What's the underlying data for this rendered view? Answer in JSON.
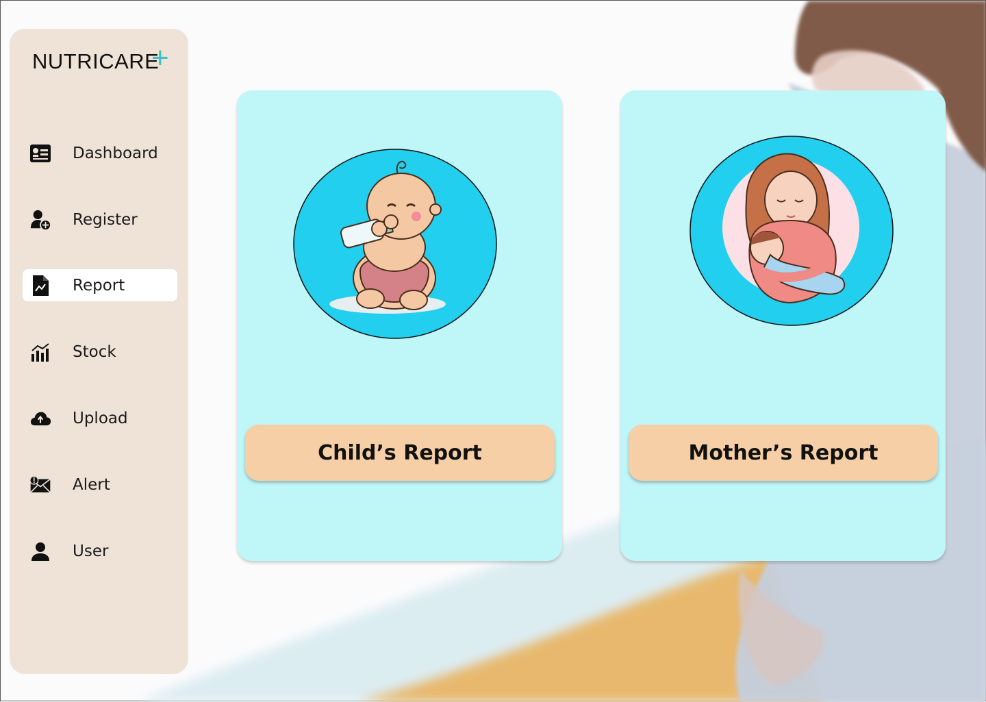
{
  "app": {
    "logo_text": "NUTRICARE",
    "logo_plus": "+",
    "accent_color": "#3ec2c9"
  },
  "sidebar": {
    "items": [
      {
        "label": "Dashboard",
        "icon": "dashboard-icon",
        "active": false
      },
      {
        "label": "Register",
        "icon": "add-user-icon",
        "active": false
      },
      {
        "label": "Report",
        "icon": "report-icon",
        "active": true
      },
      {
        "label": "Stock",
        "icon": "stock-chart-icon",
        "active": false
      },
      {
        "label": "Upload",
        "icon": "cloud-upload-icon",
        "active": false
      },
      {
        "label": "Alert",
        "icon": "alert-mail-icon",
        "active": false
      },
      {
        "label": "User",
        "icon": "user-icon",
        "active": false
      }
    ]
  },
  "cards": {
    "child": {
      "button_label": "Child’s Report",
      "image": "baby-drinking-bottle-illustration"
    },
    "mother": {
      "button_label": "Mother’s Report",
      "image": "mother-holding-baby-illustration"
    }
  },
  "colors": {
    "sidebar_bg": "#efe3d8",
    "card_bg": "#bff6f8",
    "button_bg": "#f7cfa6",
    "avatar_bg": "#22cfee"
  }
}
